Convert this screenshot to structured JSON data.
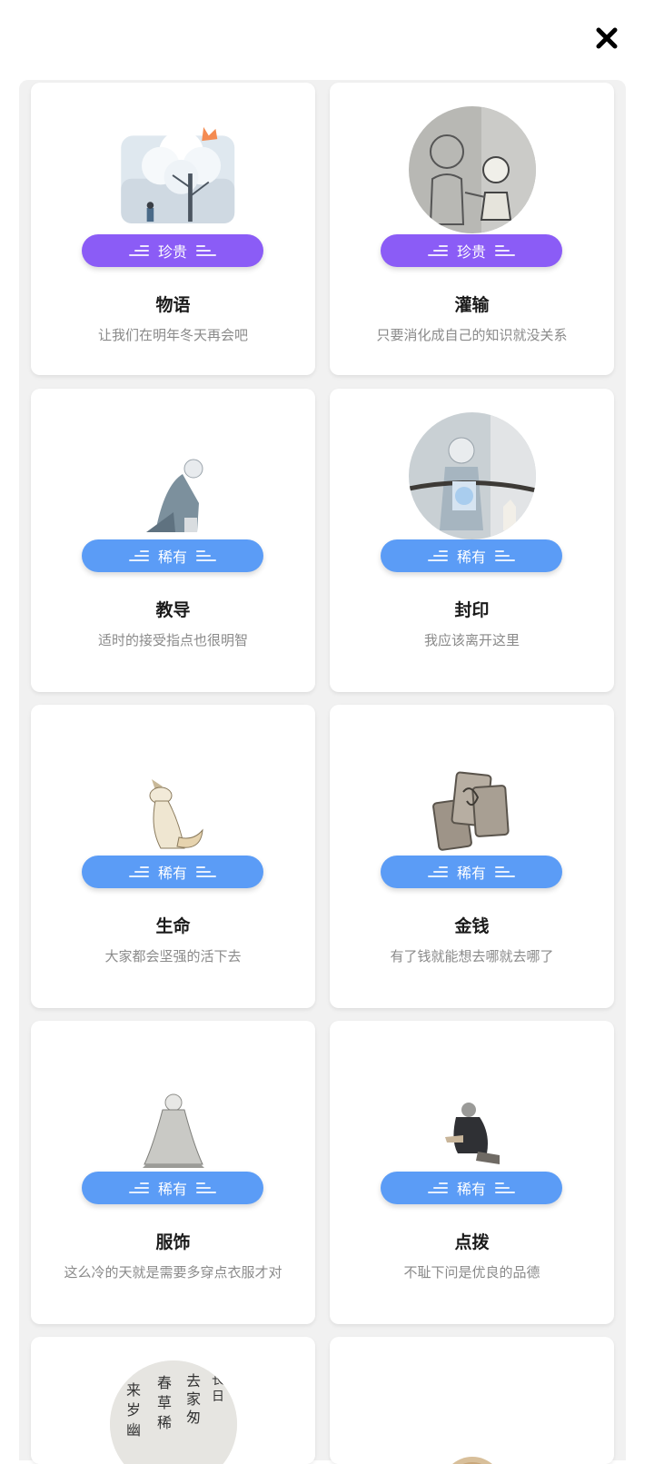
{
  "header": {
    "close_icon": "close-icon"
  },
  "colors": {
    "rare_purple": "#8b5cf6",
    "rare_blue": "#5b9cf6"
  },
  "cards": [
    {
      "title": "物语",
      "subtitle": "让我们在明年冬天再会吧",
      "badge": "珍贵",
      "art": "snow-tree"
    },
    {
      "title": "灌输",
      "subtitle": "只要消化成自己的知识就没关系",
      "badge": "珍贵",
      "art": "drawing-kids"
    },
    {
      "title": "教导",
      "subtitle": "适时的接受指点也很明智",
      "badge": "稀有",
      "art": "kneeling-figure"
    },
    {
      "title": "封印",
      "subtitle": "我应该离开这里",
      "badge": "稀有",
      "art": "sealed-rope"
    },
    {
      "title": "生命",
      "subtitle": "大家都会坚强的活下去",
      "badge": "稀有",
      "art": "fox"
    },
    {
      "title": "金钱",
      "subtitle": "有了钱就能想去哪就去哪了",
      "badge": "稀有",
      "art": "coins"
    },
    {
      "title": "服饰",
      "subtitle": "这么冷的天就是需要多穿点衣服才对",
      "badge": "稀有",
      "art": "robed-figure"
    },
    {
      "title": "点拨",
      "subtitle": "不耻下问是优良的品德",
      "badge": "稀有",
      "art": "seated-figure"
    },
    {
      "title": "",
      "subtitle": "",
      "badge": "",
      "art": "calligraphy-circle"
    },
    {
      "title": "",
      "subtitle": "",
      "badge": "",
      "art": "tan-circle"
    }
  ],
  "calligraphy": [
    "来",
    "春",
    "去",
    "长",
    "岁",
    "草",
    "家",
    "日",
    "幽",
    "稀",
    "匆"
  ]
}
